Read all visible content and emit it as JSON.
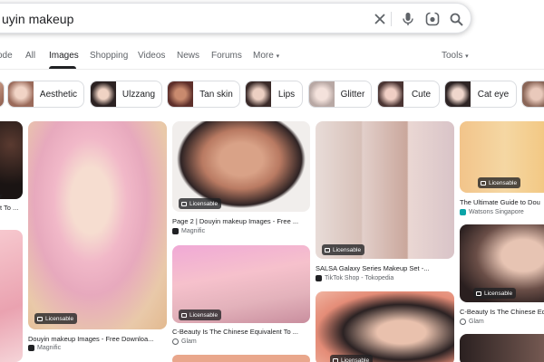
{
  "search": {
    "query": "uyin makeup"
  },
  "tabs": [
    "ode",
    "All",
    "Images",
    "Shopping",
    "Videos",
    "News",
    "Forums",
    "More"
  ],
  "tools_label": "Tools",
  "chips": [
    "Aesthetic",
    "Ulzzang",
    "Tan skin",
    "Lips",
    "Glitter",
    "Cute",
    "Cat eye"
  ],
  "badge_label": "Licensable",
  "results": [
    {
      "caption": "r",
      "caption2": "t To ..."
    },
    {
      "caption": "Douyin makeup Images - Free Downloa...",
      "source": "Magnific"
    },
    {
      "caption": "Page 2 | Douyin makeup Images - Free ...",
      "source": "Magnific"
    },
    {
      "caption": "C-Beauty Is The Chinese Equivalent To ...",
      "source": "Glam"
    },
    {
      "caption": "SALSA Galaxy Series Makeup Set -...",
      "source": "TikTok Shop - Tokopedia"
    },
    {
      "caption": "The Ultimate Guide to Dou",
      "source": "Watsons Singapore"
    },
    {
      "caption": "C-Beauty Is The Chinese Equ",
      "source": "Glam"
    }
  ],
  "colors": {
    "accent_tab": "#202124",
    "badge_bg": "#202124",
    "chip_border": "#dadce0"
  }
}
